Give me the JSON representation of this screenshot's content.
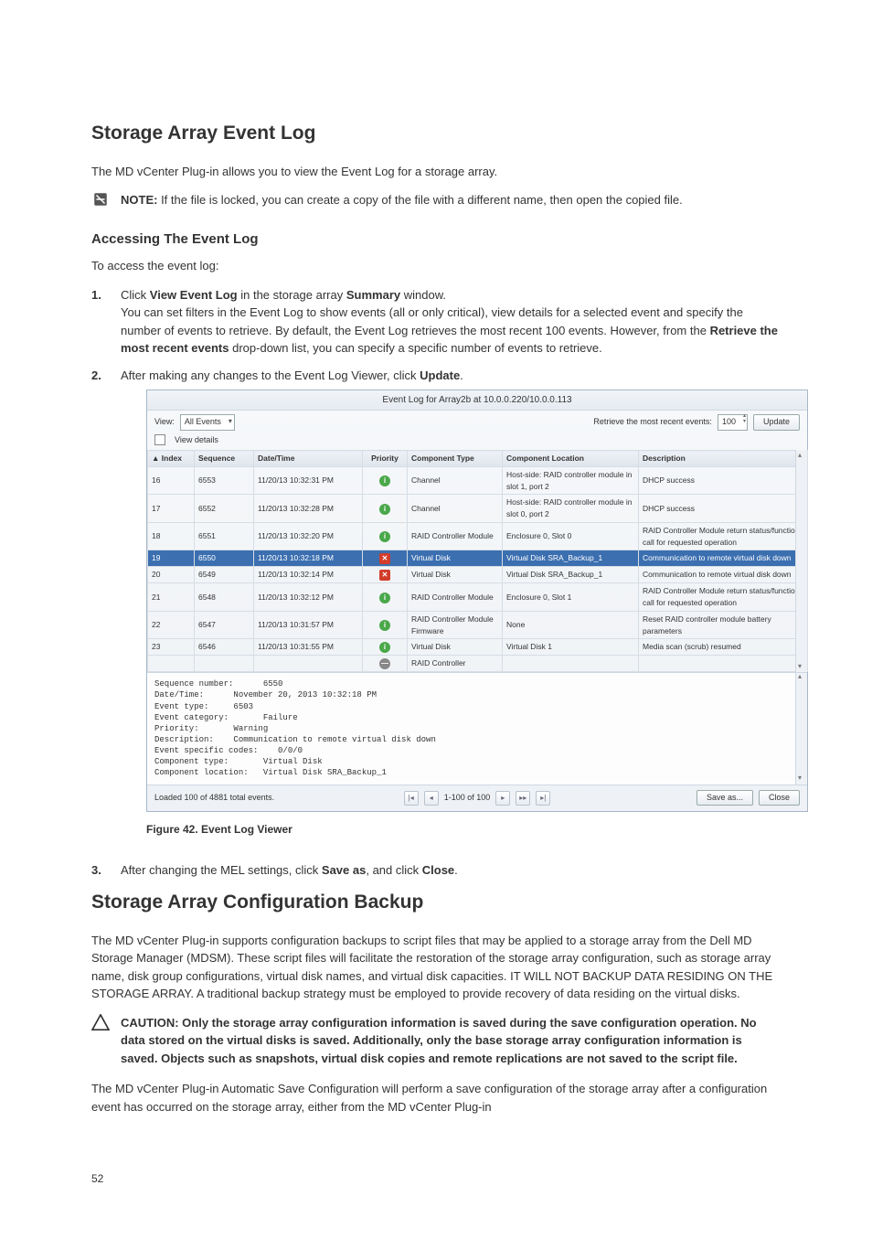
{
  "page_number": "52",
  "h2a": "Storage Array Event Log",
  "p1": "The MD vCenter Plug-in allows you to view the Event Log for a storage array.",
  "note_label": "NOTE: ",
  "note_text": "If the file is locked, you can create a copy of the file with a different name, then open the copied file.",
  "h3a": "Accessing The Event Log",
  "p2": "To access the event log:",
  "step1_a": "Click ",
  "step1_b": "View Event Log",
  "step1_c": " in the storage array ",
  "step1_d": "Summary",
  "step1_e": " window.",
  "step1_para_a": "You can set filters in the Event Log to show events (all or only critical), view details for a selected event and specify the number of events to retrieve. By default, the Event Log retrieves the most recent 100 events. However, from the ",
  "step1_para_b": "Retrieve the most recent events",
  "step1_para_c": " drop-down list, you can specify a specific number of events to retrieve.",
  "step2_a": "After making any changes to the Event Log Viewer, click ",
  "step2_b": "Update",
  "step2_c": ".",
  "fig_caption": "Figure 42. Event Log Viewer",
  "step3_a": "After changing the MEL settings, click ",
  "step3_b": "Save as",
  "step3_c": ", and click ",
  "step3_d": "Close",
  "step3_e": ".",
  "h2b": "Storage Array Configuration Backup",
  "p3": "The MD vCenter Plug-in supports configuration backups to script files that may be applied to a storage array from the Dell MD Storage Manager (MDSM). These script files will facilitate the restoration of the storage array configuration, such as storage array name, disk group configurations, virtual disk names, and virtual disk capacities. IT WILL NOT BACKUP DATA RESIDING ON THE STORAGE ARRAY. A traditional backup strategy must be employed to provide recovery of data residing on the virtual disks.",
  "caution_label": "CAUTION: ",
  "caution_text": "Only the storage array configuration information is saved during the save configuration operation. No data stored on the virtual disks is saved. Additionally, only the base storage array configuration information is saved. Objects such as snapshots, virtual disk copies and remote replications are not saved to the script file.",
  "p4": "The MD vCenter Plug-in Automatic Save Configuration will perform a save configuration of the storage array after a configuration event has occurred on the storage array, either from the MD vCenter Plug-in",
  "shot": {
    "title": "Event Log for Array2b at 10.0.0.220/10.0.0.113",
    "view_label": "View:",
    "view_value": "All Events",
    "retrieve_label": "Retrieve the most recent events:",
    "retrieve_value": "100",
    "update_btn": "Update",
    "view_details": "View details",
    "cols": {
      "idx": "▲ Index",
      "seq": "Sequence",
      "dt": "Date/Time",
      "pri": "Priority",
      "ct": "Component Type",
      "cl": "Component Location",
      "desc": "Description"
    },
    "rows": [
      {
        "idx": "16",
        "seq": "6553",
        "dt": "11/20/13 10:32:31 PM",
        "pri": "info",
        "ct": "Channel",
        "cl": "Host-side: RAID controller module in slot 1, port 2",
        "desc": "DHCP success"
      },
      {
        "idx": "17",
        "seq": "6552",
        "dt": "11/20/13 10:32:28 PM",
        "pri": "info",
        "ct": "Channel",
        "cl": "Host-side: RAID controller module in slot 0, port 2",
        "desc": "DHCP success"
      },
      {
        "idx": "18",
        "seq": "6551",
        "dt": "11/20/13 10:32:20 PM",
        "pri": "info",
        "ct": "RAID Controller Module",
        "cl": "Enclosure 0, Slot 0",
        "desc": "RAID Controller Module return status/function call for requested operation"
      },
      {
        "idx": "19",
        "seq": "6550",
        "dt": "11/20/13 10:32:18 PM",
        "pri": "crit",
        "ct": "Virtual Disk",
        "cl": "Virtual Disk SRA_Backup_1",
        "desc": "Communication to remote virtual disk down",
        "sel": true
      },
      {
        "idx": "20",
        "seq": "6549",
        "dt": "11/20/13 10:32:14 PM",
        "pri": "crit",
        "ct": "Virtual Disk",
        "cl": "Virtual Disk SRA_Backup_1",
        "desc": "Communication to remote virtual disk down"
      },
      {
        "idx": "21",
        "seq": "6548",
        "dt": "11/20/13 10:32:12 PM",
        "pri": "info",
        "ct": "RAID Controller Module",
        "cl": "Enclosure 0, Slot 1",
        "desc": "RAID Controller Module return status/function call for requested operation"
      },
      {
        "idx": "22",
        "seq": "6547",
        "dt": "11/20/13 10:31:57 PM",
        "pri": "info",
        "ct": "RAID Controller Module Firmware",
        "cl": "None",
        "desc": "Reset RAID controller module battery parameters"
      },
      {
        "idx": "23",
        "seq": "6546",
        "dt": "11/20/13 10:31:55 PM",
        "pri": "info",
        "ct": "Virtual Disk",
        "cl": "Virtual Disk 1",
        "desc": "Media scan (scrub) resumed"
      }
    ],
    "last_ct": "RAID Controller",
    "details": "Sequence number:      6550\nDate/Time:      November 20, 2013 10:32:18 PM\nEvent type:     6503\nEvent category:       Failure\nPriority:       Warning\nDescription:    Communication to remote virtual disk down\nEvent specific codes:    0/0/0\nComponent type:       Virtual Disk\nComponent location:   Virtual Disk SRA_Backup_1",
    "loaded": "Loaded 100 of 4881 total events.",
    "range": "1-100 of 100",
    "save_as": "Save as...",
    "close": "Close"
  }
}
